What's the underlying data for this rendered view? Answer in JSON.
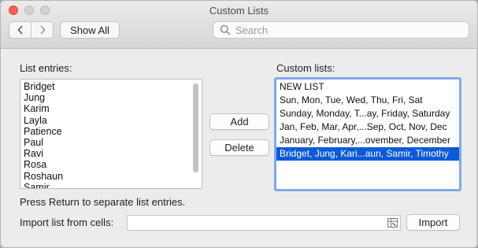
{
  "window": {
    "title": "Custom Lists"
  },
  "toolbar": {
    "show_all_label": "Show All",
    "search_placeholder": "Search",
    "back_icon": "chevron-left-icon",
    "forward_icon": "chevron-right-icon"
  },
  "list_entries": {
    "label": "List entries:",
    "items": [
      "Bridget",
      "Jung",
      "Karim",
      "Layla",
      "Patience",
      "Paul",
      "Ravi",
      "Rosa",
      "Roshaun",
      "Samir"
    ]
  },
  "custom_lists": {
    "label": "Custom lists:",
    "items": [
      "NEW LIST",
      "Sun, Mon, Tue, Wed, Thu, Fri, Sat",
      "Sunday, Monday, T...ay, Friday, Saturday",
      "Jan, Feb, Mar, Apr,...Sep, Oct, Nov, Dec",
      "January, February,...ovember, December",
      "Bridget, Jung, Kari...aun, Samir, Timothy"
    ],
    "selected_index": 5
  },
  "buttons": {
    "add": "Add",
    "delete": "Delete",
    "import": "Import"
  },
  "hint": "Press Return to separate list entries.",
  "import": {
    "label": "Import list from cells:",
    "value": ""
  },
  "colors": {
    "selection": "#0b5ad9",
    "focus_ring": "#7fa9e6",
    "close": "#fe5f57"
  }
}
